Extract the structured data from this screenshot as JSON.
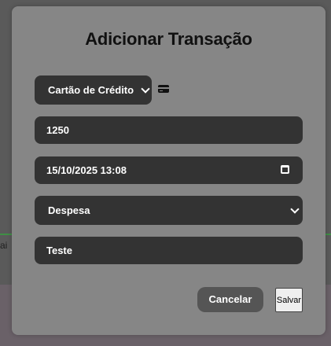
{
  "background": {
    "partial_text": "ai"
  },
  "modal": {
    "title": "Adicionar Transação",
    "payment_method": {
      "selected": "Cartão de Crédito",
      "icon": "credit-card-icon"
    },
    "amount": {
      "value": "1250"
    },
    "datetime": {
      "value": "15/10/2025 13:08",
      "icon": "calendar-icon"
    },
    "type": {
      "selected": "Despesa"
    },
    "description": {
      "value": "Teste"
    },
    "buttons": {
      "cancel_label": "Cancelar",
      "save_label": "Salvar"
    }
  },
  "colors": {
    "overlay_background": "#4f4f4f",
    "modal_background": "#868686",
    "field_background": "#333333",
    "cancel_button": "#555555",
    "save_button": "#efefef",
    "accent_line": "#3f8f45"
  }
}
